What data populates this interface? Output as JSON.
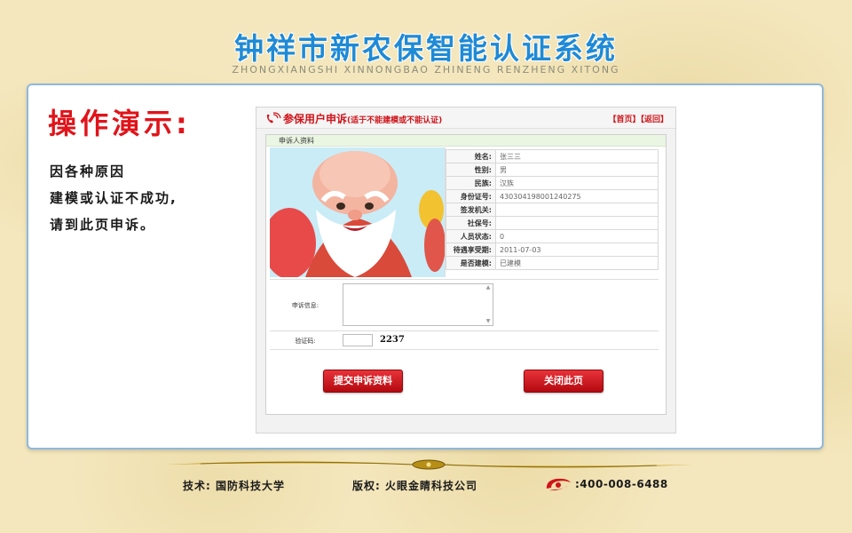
{
  "header": {
    "title": "钟祥市新农保智能认证系统",
    "subtitle": "ZHONGXIANGSHI XINNONGBAO ZHINENG RENZHENG XITONG"
  },
  "demo": {
    "title": "操作演示:",
    "lines": [
      "因各种原因",
      "建模或认证不成功,",
      "请到此页申诉。"
    ]
  },
  "screenshot": {
    "title": "参保用户申诉",
    "title_note": "(适于不能建模或不能认证)",
    "link_home": "【首页】",
    "link_back": "【返回】",
    "section_label": "申诉人资料",
    "fields": [
      {
        "label": "姓名:",
        "value": "张三三"
      },
      {
        "label": "性别:",
        "value": "男"
      },
      {
        "label": "民族:",
        "value": "汉族"
      },
      {
        "label": "身份证号:",
        "value": "430304198001240275"
      },
      {
        "label": "签发机关:",
        "value": ""
      },
      {
        "label": "社保号:",
        "value": ""
      },
      {
        "label": "人员状态:",
        "value": "0"
      },
      {
        "label": "待遇享受期:",
        "value": "2011-07-03"
      },
      {
        "label": "是否建模:",
        "value": "已建模"
      }
    ],
    "appeal_label": "申诉信息:",
    "appeal_value": "",
    "captcha_label": "验证码:",
    "captcha_value": "",
    "captcha_code": "2237",
    "submit_label": "提交申诉资料",
    "close_label": "关闭此页"
  },
  "footer": {
    "tech": "技术: 国防科技大学",
    "copyright": "版权: 火眼金睛科技公司",
    "phone": ":400-008-6488"
  },
  "colors": {
    "title_blue": "#1f8ad6",
    "accent_red": "#e0141a",
    "panel_border": "#8fb8de"
  }
}
